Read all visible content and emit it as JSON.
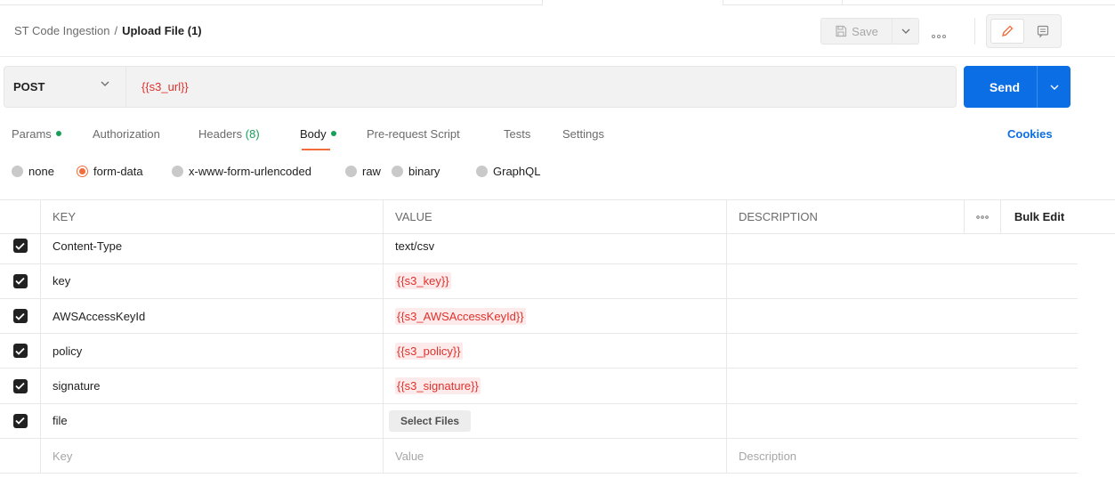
{
  "header": {
    "breadcrumb_parent": "ST Code Ingestion",
    "breadcrumb_separator": "/",
    "breadcrumb_current": "Upload File (1)",
    "save_label": "Save"
  },
  "request": {
    "method": "POST",
    "url": "{{s3_url}}",
    "send_label": "Send"
  },
  "tabs": [
    {
      "label": "Params",
      "dot": true
    },
    {
      "label": "Authorization"
    },
    {
      "label": "Headers",
      "count": "(8)"
    },
    {
      "label": "Body",
      "dot": true,
      "active": true
    },
    {
      "label": "Pre-request Script"
    },
    {
      "label": "Tests"
    },
    {
      "label": "Settings"
    }
  ],
  "cookies_label": "Cookies",
  "body_types": [
    {
      "label": "none",
      "selected": false
    },
    {
      "label": "form-data",
      "selected": true
    },
    {
      "label": "x-www-form-urlencoded",
      "selected": false
    },
    {
      "label": "raw",
      "selected": false
    },
    {
      "label": "binary",
      "selected": false
    },
    {
      "label": "GraphQL",
      "selected": false
    }
  ],
  "table": {
    "columns": {
      "key": "KEY",
      "value": "VALUE",
      "description": "DESCRIPTION",
      "bulk_edit": "Bulk Edit"
    },
    "rows": [
      {
        "checked": true,
        "key": "Content-Type",
        "value": "text/csv",
        "is_variable": false,
        "is_file": false
      },
      {
        "checked": true,
        "key": "key",
        "value": "{{s3_key}}",
        "is_variable": true,
        "is_file": false
      },
      {
        "checked": true,
        "key": "AWSAccessKeyId",
        "value": "{{s3_AWSAccessKeyId}}",
        "is_variable": true,
        "is_file": false
      },
      {
        "checked": true,
        "key": "policy",
        "value": "{{s3_policy}}",
        "is_variable": true,
        "is_file": false
      },
      {
        "checked": true,
        "key": "signature",
        "value": "{{s3_signature}}",
        "is_variable": true,
        "is_file": false
      },
      {
        "checked": true,
        "key": "file",
        "value": "Select Files",
        "is_variable": false,
        "is_file": true
      }
    ],
    "placeholders": {
      "key": "Key",
      "value": "Value",
      "description": "Description"
    }
  },
  "colors": {
    "accent": "#f26b3a",
    "primary": "#0c6ee4",
    "variable": "#e0312c",
    "success": "#18a058"
  }
}
